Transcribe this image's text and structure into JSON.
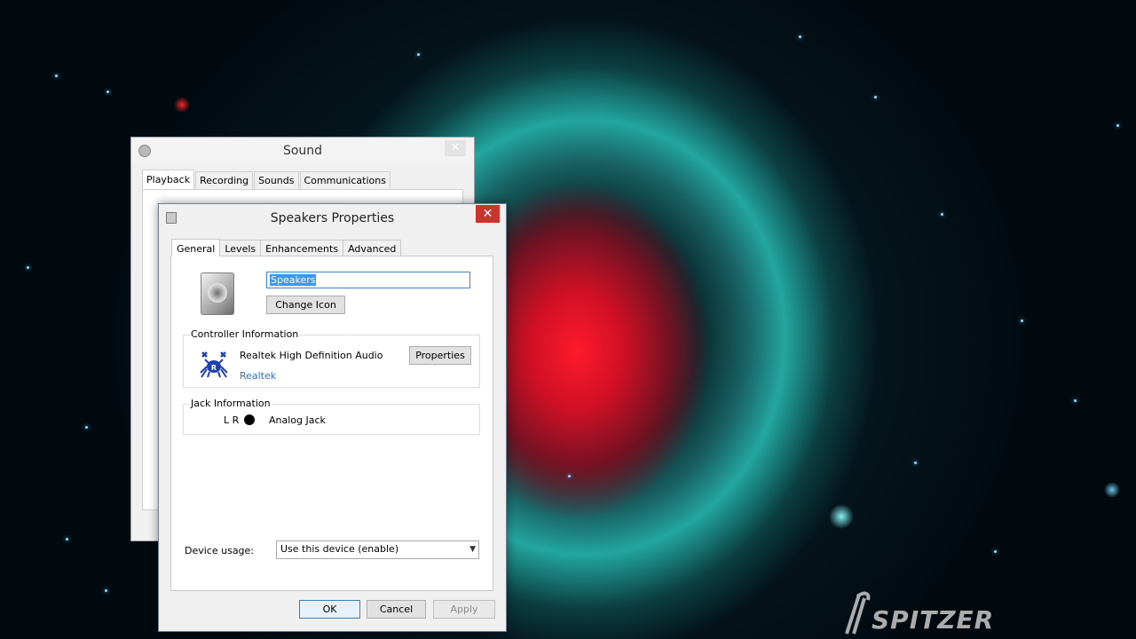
{
  "desktop": {
    "watermark": "SPITZER"
  },
  "sound_window": {
    "title": "Sound",
    "close_label": "✕",
    "tabs": [
      {
        "label": "Playback",
        "active": true
      },
      {
        "label": "Recording",
        "active": false
      },
      {
        "label": "Sounds",
        "active": false
      },
      {
        "label": "Communications",
        "active": false
      }
    ]
  },
  "speakers_properties": {
    "title": "Speakers Properties",
    "close_label": "✕",
    "tabs": [
      {
        "label": "General",
        "active": true
      },
      {
        "label": "Levels",
        "active": false
      },
      {
        "label": "Enhancements",
        "active": false
      },
      {
        "label": "Advanced",
        "active": false
      }
    ],
    "device_name": "Speakers",
    "change_icon_label": "Change Icon",
    "controller": {
      "group_title": "Controller Information",
      "name": "Realtek High Definition Audio",
      "vendor_link": "Realtek",
      "properties_label": "Properties",
      "logo_icon": "realtek-crab-icon"
    },
    "jack": {
      "group_title": "Jack Information",
      "channels": "L R",
      "type": "Analog Jack"
    },
    "device_usage": {
      "label": "Device usage:",
      "selected": "Use this device (enable)"
    },
    "buttons": {
      "ok": "OK",
      "cancel": "Cancel",
      "apply": "Apply"
    }
  }
}
